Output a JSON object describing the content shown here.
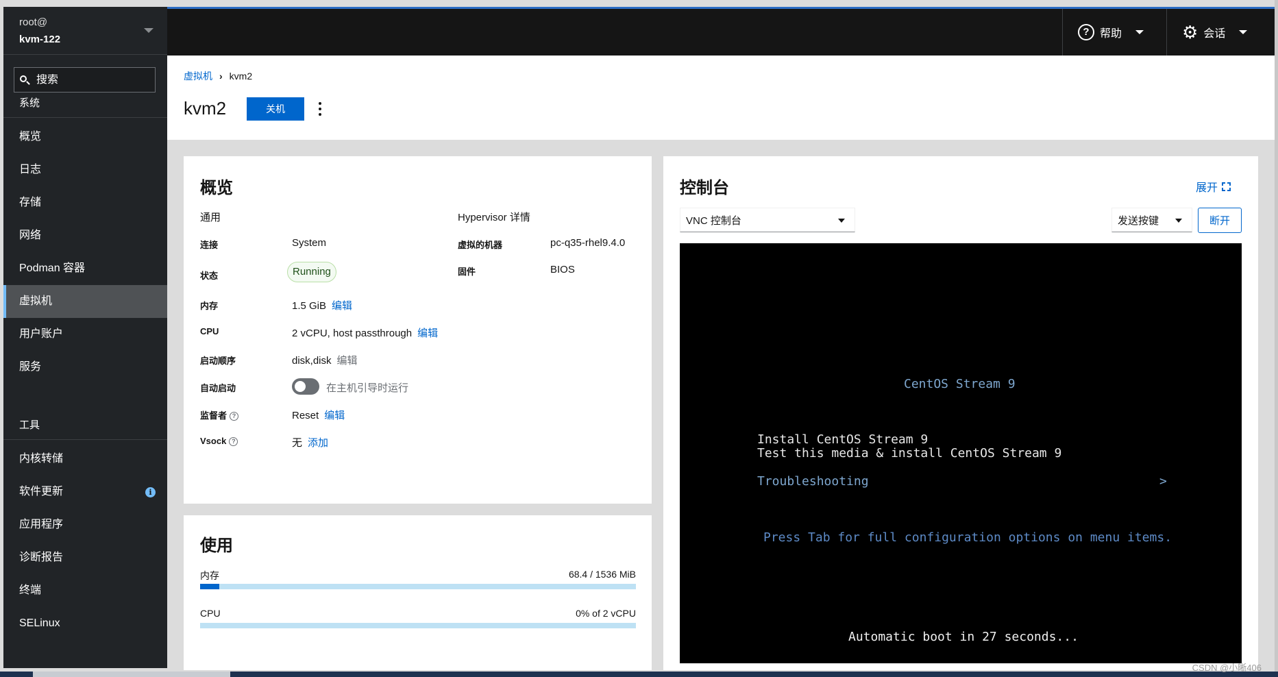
{
  "sidebar": {
    "user": "root@",
    "host": "kvm-122",
    "search_placeholder": "搜索",
    "section_system": "系统",
    "system_items": [
      {
        "label": "概览"
      },
      {
        "label": "日志"
      },
      {
        "label": "存储"
      },
      {
        "label": "网络"
      },
      {
        "label": "Podman 容器"
      },
      {
        "label": "虚拟机"
      },
      {
        "label": "用户账户"
      },
      {
        "label": "服务"
      }
    ],
    "section_tools": "工具",
    "tool_items": [
      {
        "label": "内核转储"
      },
      {
        "label": "软件更新",
        "badge": "i"
      },
      {
        "label": "应用程序"
      },
      {
        "label": "诊断报告"
      },
      {
        "label": "终端"
      },
      {
        "label": "SELinux"
      }
    ],
    "active_item": "虚拟机"
  },
  "topbar": {
    "help_label": "帮助",
    "session_label": "会话",
    "help_icon": "question-circle-icon",
    "session_icon": "gear-icon"
  },
  "header": {
    "breadcrumb_root": "虚拟机",
    "breadcrumb_current": "kvm2",
    "title": "kvm2",
    "shutdown_label": "关机"
  },
  "overview": {
    "title": "概览",
    "general_heading": "通用",
    "hypervisor_heading": "Hypervisor 详情",
    "connection_label": "连接",
    "connection_value": "System",
    "state_label": "状态",
    "state_value": "Running",
    "memory_label": "内存",
    "memory_value": "1.5 GiB",
    "cpu_label": "CPU",
    "cpu_value": "2 vCPU, host passthrough",
    "boot_order_label": "启动顺序",
    "boot_order_value": "disk,disk",
    "autostart_label": "自动启动",
    "autostart_value": "在主机引导时运行",
    "autostart_on": false,
    "watchdog_label": "监督者",
    "watchdog_value": "Reset",
    "vsock_label": "Vsock",
    "vsock_value": "无",
    "edit_label": "编辑",
    "add_label": "添加",
    "machine_label": "虚拟的机器",
    "machine_value": "pc-q35-rhel9.4.0",
    "firmware_label": "固件",
    "firmware_value": "BIOS"
  },
  "usage": {
    "title": "使用",
    "memory_label": "内存",
    "memory_value": "68.4 / 1536 MiB",
    "memory_fraction": 0.0445,
    "cpu_label": "CPU",
    "cpu_value": "0% of 2 vCPU",
    "cpu_fraction": 0
  },
  "console": {
    "title": "控制台",
    "expand_label": "展开",
    "console_type": "VNC 控制台",
    "send_keys_label": "发送按键",
    "disconnect_label": "断开",
    "screen": {
      "heading": "CentOS Stream 9",
      "menu_selected": "Install CentOS Stream 9",
      "menu_item2": "Test this media & install CentOS Stream 9",
      "menu_item3": "Troubleshooting",
      "menu_arrow": ">",
      "hint": "Press Tab for full configuration options on menu items.",
      "countdown": "Automatic boot in 27 seconds..."
    }
  },
  "watermark": "CSDN @小晰406",
  "colors": {
    "accent": "#0066cc",
    "sidebar_bg": "#212427",
    "topbar_bg": "#151515",
    "vnc_blue": "#7ea7cf"
  }
}
